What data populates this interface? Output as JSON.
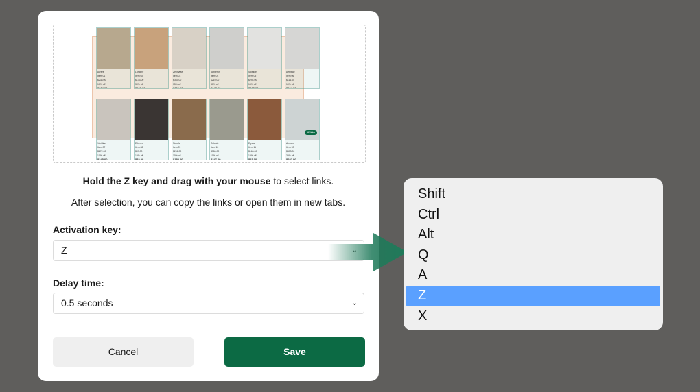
{
  "instructions": {
    "bold_part": "Hold the Z key and drag with your mouse",
    "rest_part": " to select links.",
    "line2": "After selection, you can copy the links or open them in new tabs."
  },
  "activation": {
    "label": "Activation key:",
    "value": "Z"
  },
  "delay": {
    "label": "Delay time:",
    "value": "0.5 seconds"
  },
  "buttons": {
    "cancel": "Cancel",
    "save": "Save"
  },
  "dropdown_options": [
    "Shift",
    "Ctrl",
    "Alt",
    "Q",
    "A",
    "Z",
    "X"
  ],
  "dropdown_selected": "Z",
  "preview": {
    "badge": "12 links",
    "cards": [
      {
        "brand": "Alzere",
        "name": "Item 01",
        "orig": "$238.00",
        "off": "10% off",
        "price": "$214.00",
        "img": "#b7a88e"
      },
      {
        "brand": "Lumiere",
        "name": "Item 02",
        "orig": "$173.00",
        "off": "30% off",
        "price": "$121.00",
        "img": "#c8a27c"
      },
      {
        "brand": "Zephyrae",
        "name": "Item 03",
        "orig": "$363.00",
        "off": "15% off",
        "price": "$309.00",
        "img": "#d8d1c6"
      },
      {
        "brand": "Aetheron",
        "name": "Item 04",
        "orig": "$210.00",
        "off": "30% off",
        "price": "$147.00",
        "img": "#cfcfcc"
      },
      {
        "brand": "Solstice",
        "name": "Item 05",
        "orig": "$294.00",
        "off": "15% off",
        "price": "$265.00",
        "img": "#e2e2e0"
      },
      {
        "brand": "Aetheae",
        "name": "Item 06",
        "orig": "$116.00",
        "off": "10% off",
        "price": "$104.00",
        "img": "#d6d6d4"
      },
      {
        "brand": "Veridian",
        "name": "Item 07",
        "orig": "$272.00",
        "off": "10% off",
        "price": "$245.00",
        "img": "#c9c4bd"
      },
      {
        "brand": "Ethereo",
        "name": "Item 08",
        "orig": "$97.00",
        "off": "15% off",
        "price": "$82.00",
        "img": "#3a3533"
      },
      {
        "brand": "Nebula",
        "name": "Item 09",
        "orig": "$206.00",
        "off": "10% off",
        "price": "$185.00",
        "img": "#8a6b4c"
      },
      {
        "brand": "Celeste",
        "name": "Item 10",
        "orig": "$386.00",
        "off": "10% off",
        "price": "$347.00",
        "img": "#9a9a8e"
      },
      {
        "brand": "Elysia",
        "name": "Item 11",
        "orig": "$166.00",
        "off": "10% off",
        "price": "$15.00",
        "img": "#8b5a3c"
      },
      {
        "brand": "Ambers",
        "name": "Item 12",
        "orig": "$403.00",
        "off": "30% off",
        "price": "$282.00",
        "img": "#cdd3d3"
      }
    ]
  }
}
